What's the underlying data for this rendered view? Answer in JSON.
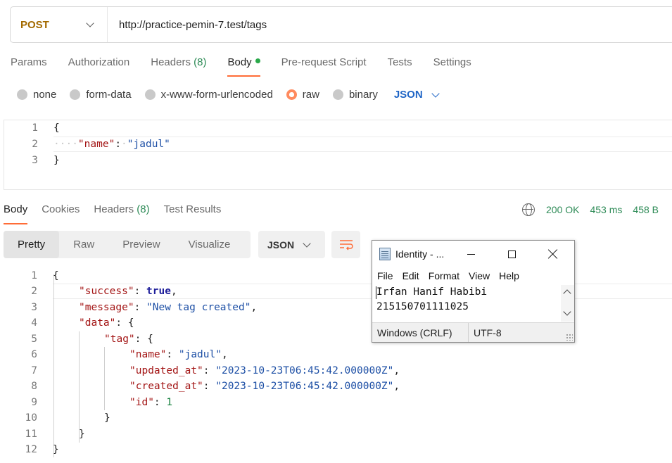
{
  "request": {
    "method": "POST",
    "url": "http://practice-pemin-7.test/tags",
    "tabs": [
      {
        "label": "Params"
      },
      {
        "label": "Authorization"
      },
      {
        "label": "Headers",
        "count": "(8)"
      },
      {
        "label": "Body"
      },
      {
        "label": "Pre-request Script"
      },
      {
        "label": "Tests"
      },
      {
        "label": "Settings"
      }
    ],
    "body_types": [
      "none",
      "form-data",
      "x-www-form-urlencoded",
      "raw",
      "binary"
    ],
    "body_type_selected": "raw",
    "format": "JSON",
    "code_lines": [
      {
        "n": "1",
        "text": "{"
      },
      {
        "n": "2",
        "key": "\"name\"",
        "value": "\"jadul\""
      },
      {
        "n": "3",
        "text": "}"
      }
    ]
  },
  "response": {
    "tabs": [
      {
        "label": "Body"
      },
      {
        "label": "Cookies"
      },
      {
        "label": "Headers",
        "count": "(8)"
      },
      {
        "label": "Test Results"
      }
    ],
    "status": "200 OK",
    "time": "453 ms",
    "size": "458 B",
    "views": [
      "Pretty",
      "Raw",
      "Preview",
      "Visualize"
    ],
    "format": "JSON",
    "line_numbers": [
      "1",
      "2",
      "3",
      "4",
      "5",
      "6",
      "7",
      "8",
      "9",
      "10",
      "11",
      "12"
    ],
    "json": {
      "open": "{",
      "success_key": "\"success\"",
      "success_val": "true",
      "message_key": "\"message\"",
      "message_val": "\"New tag created\"",
      "data_key": "\"data\"",
      "tag_key": "\"tag\"",
      "name_key": "\"name\"",
      "name_val": "\"jadul\"",
      "updated_key": "\"updated_at\"",
      "updated_val": "\"2023-10-23T06:45:42.000000Z\"",
      "created_key": "\"created_at\"",
      "created_val": "\"2023-10-23T06:45:42.000000Z\"",
      "id_key": "\"id\"",
      "id_val": "1",
      "close": "}"
    }
  },
  "notepad": {
    "title": "Identity - ...",
    "menu": [
      "File",
      "Edit",
      "Format",
      "View",
      "Help"
    ],
    "lines": [
      "Irfan Hanif Habibi",
      "215150701111025"
    ],
    "line_ending": "Windows (CRLF)",
    "encoding": "UTF-8"
  },
  "colors": {
    "accent": "#ff6c37",
    "method": "#a36a00",
    "status_ok": "#2e8b57",
    "format_link": "#1f65c6"
  }
}
